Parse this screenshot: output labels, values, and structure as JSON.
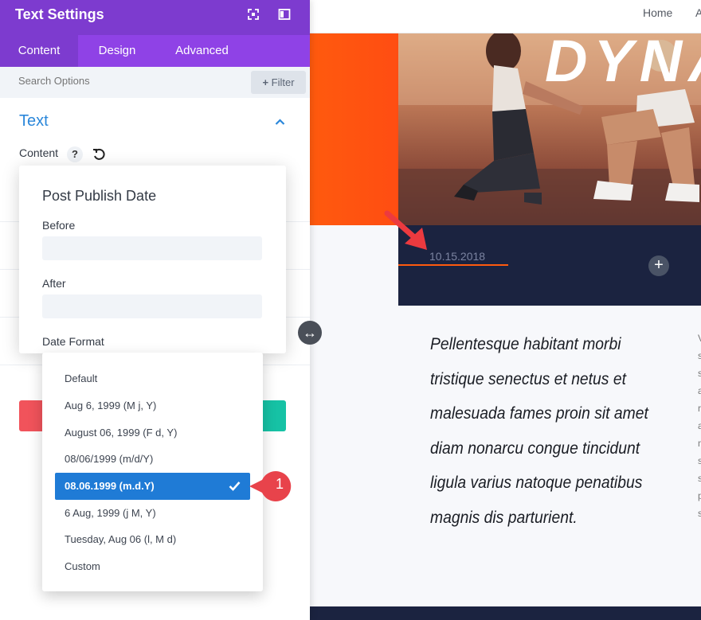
{
  "preview": {
    "nav": {
      "home": "Home",
      "second": "A"
    },
    "hero_title": "DYNA",
    "date": "10.15.2018",
    "add_label": "+",
    "quote": "Pellentesque habitant morbi tristique senectus et netus et malesuada fames proin sit amet diam nonarcu congue tincidunt ligula varius natoque penatibus magnis dis parturient.",
    "side_letters": [
      "V",
      "s",
      "s",
      "a",
      "r",
      "a",
      "m",
      "s",
      "s",
      "p",
      "s"
    ],
    "resize_icon": "↔"
  },
  "panel": {
    "title": "Text Settings",
    "tabs": [
      "Content",
      "Design",
      "Advanced"
    ],
    "search_placeholder": "Search Options",
    "filter_label": "Filter",
    "filter_icon": "+",
    "section_title": "Text",
    "content_label": "Content",
    "help_label": "?"
  },
  "modal": {
    "title": "Post Publish Date",
    "before_label": "Before",
    "after_label": "After",
    "format_label": "Date Format"
  },
  "dropdown": {
    "options": [
      "Default",
      "Aug 6, 1999 (M j, Y)",
      "August 06, 1999 (F d, Y)",
      "08/06/1999 (m/d/Y)",
      "08.06.1999 (m.d.Y)",
      "6 Aug, 1999 (j M, Y)",
      "Tuesday, Aug 06 (l, M d)",
      "Custom"
    ],
    "selected_index": 4
  },
  "callout": {
    "number": "1"
  },
  "colors": {
    "header_purple": "#7d3bcf",
    "tab_purple": "#8f42e6",
    "accent_blue": "#2b87da",
    "selected_blue": "#1f7bd6",
    "orange": "#ff5a0e",
    "navy": "#1b2340",
    "callout_red": "#e8434b",
    "teal": "#16c2a5"
  }
}
